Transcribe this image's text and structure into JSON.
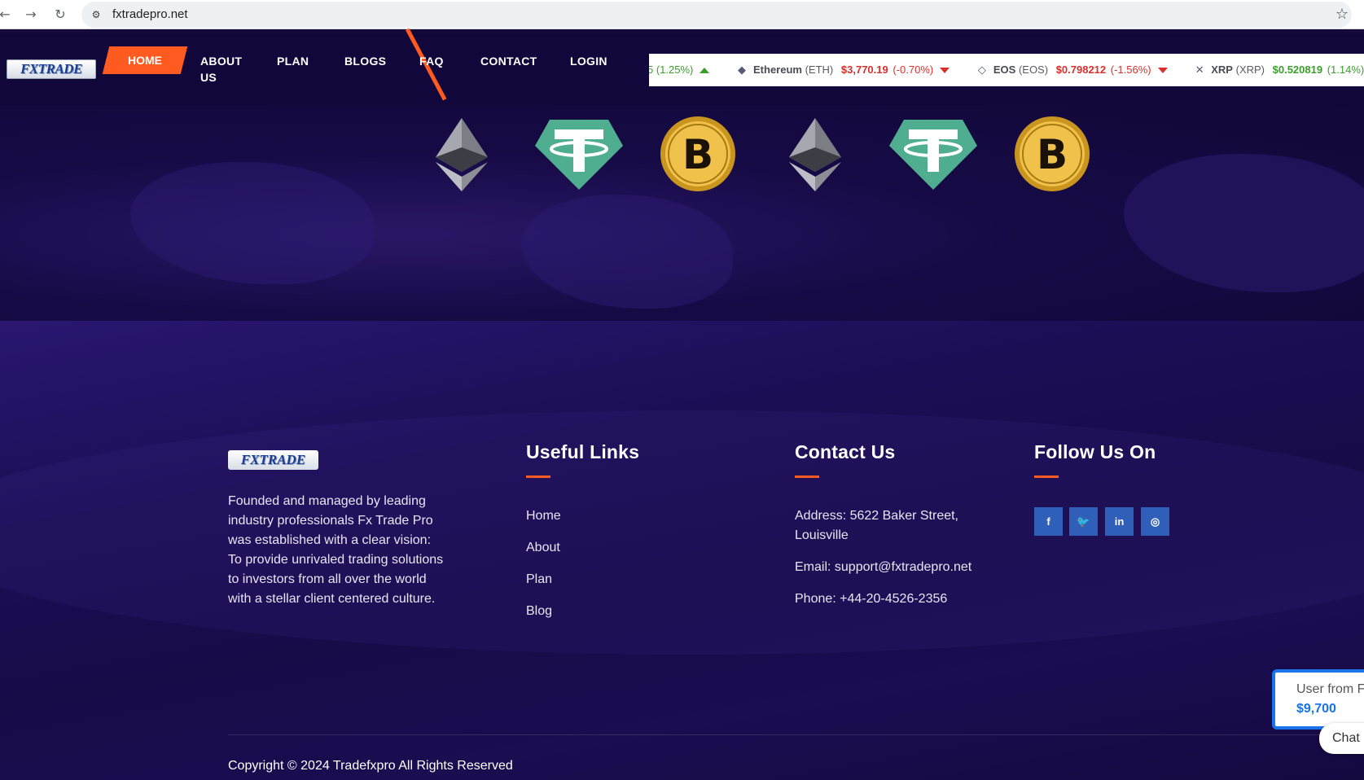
{
  "browser": {
    "url": "fxtradepro.net",
    "back_icon": "←",
    "forward_icon": "→",
    "reload_icon": "↻",
    "site_info_icon": "⚙",
    "bookmark_icon": "☆"
  },
  "header": {
    "logo_text": "FXTRADE",
    "nav": {
      "home": "HOME",
      "about": "ABOUT US",
      "plan": "PLAN",
      "blogs": "BLOGS",
      "faq": "FAQ",
      "contact": "CONTACT",
      "login": "LOGIN"
    },
    "accent_color": "#ff5a1f"
  },
  "ticker": {
    "items": [
      {
        "name": "",
        "symbol": "",
        "price": "",
        "change": "5 (1.25%)",
        "trend": "up"
      },
      {
        "name": "Ethereum",
        "symbol": "(ETH)",
        "price": "$3,770.19",
        "change": "(-0.70%)",
        "trend": "down"
      },
      {
        "name": "EOS",
        "symbol": "(EOS)",
        "price": "$0.798212",
        "change": "(-1.56%)",
        "trend": "down"
      },
      {
        "name": "XRP",
        "symbol": "(XRP)",
        "price": "$0.520819",
        "change": "(1.14%)",
        "trend": "up"
      }
    ]
  },
  "hero": {
    "coins": [
      "ethereum-icon",
      "tether-icon",
      "bitcoin-icon",
      "ethereum-icon",
      "tether-icon",
      "bitcoin-icon"
    ]
  },
  "footer": {
    "logo_text": "FXTRADE",
    "about": "Founded and managed by leading industry professionals Fx Trade Pro was established with a clear vision: To provide unrivaled trading solutions to investors from all over the world with a stellar client centered culture.",
    "useful_links": {
      "title": "Useful Links",
      "links": [
        "Home",
        "About",
        "Plan",
        "Blog"
      ]
    },
    "contact": {
      "title": "Contact Us",
      "address": "Address: 5622 Baker Street, Louisville",
      "email": "Email: support@fxtradepro.net",
      "phone": "Phone: +44-20-4526-2356"
    },
    "follow": {
      "title": "Follow Us On",
      "social": [
        {
          "name": "facebook",
          "glyph": "f"
        },
        {
          "name": "twitter",
          "glyph": "🐦"
        },
        {
          "name": "linkedin",
          "glyph": "in"
        },
        {
          "name": "instagram",
          "glyph": "◎"
        }
      ]
    },
    "copyright": "Copyright © 2024 Tradefxpro All Rights Reserved"
  },
  "notification": {
    "line1": "User from F",
    "amount": "$9,700"
  },
  "chat": {
    "label": "Chat"
  }
}
